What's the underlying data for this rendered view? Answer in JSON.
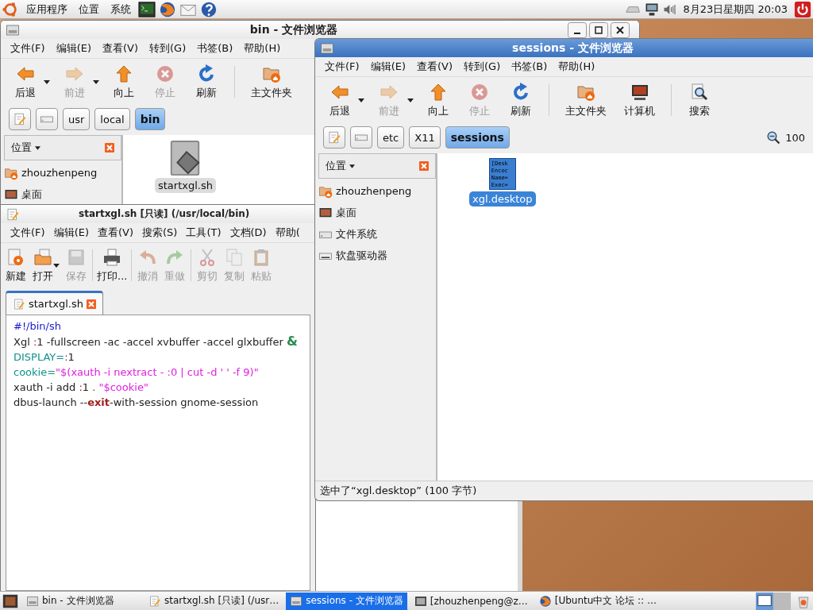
{
  "top_panel": {
    "menus": [
      {
        "label": "应用程序"
      },
      {
        "label": "位置"
      },
      {
        "label": "系统"
      }
    ],
    "clock": "8月23日星期四 20:03"
  },
  "file_browsers": [
    {
      "title": "bin - 文件浏览器",
      "active": false,
      "window_controls": true,
      "menu": [
        "文件(F)",
        "编辑(E)",
        "查看(V)",
        "转到(G)",
        "书签(B)",
        "帮助(H)"
      ],
      "toolbar": [
        {
          "kind": "back",
          "label": "后退",
          "disabled": false,
          "has_menu": true
        },
        {
          "kind": "forward",
          "label": "前进",
          "disabled": true,
          "has_menu": true
        },
        {
          "kind": "up",
          "label": "向上",
          "disabled": false,
          "has_menu": false
        },
        {
          "kind": "stop",
          "label": "停止",
          "disabled": true,
          "has_menu": false
        },
        {
          "kind": "reload",
          "label": "刷新",
          "disabled": false,
          "has_menu": false
        },
        {
          "kind": "separator"
        },
        {
          "kind": "home",
          "label": "主文件夹",
          "disabled": false,
          "has_menu": false
        }
      ],
      "path": [
        {
          "kind": "edit",
          "selected": false
        },
        {
          "kind": "disk",
          "selected": false
        },
        {
          "kind": "folder",
          "label": "usr",
          "selected": false
        },
        {
          "kind": "folder",
          "label": "local",
          "selected": false
        },
        {
          "kind": "folder",
          "label": "bin",
          "selected": true
        }
      ],
      "sidebar": {
        "title": "位置",
        "places": [
          {
            "kind": "home",
            "label": "zhouzhenpeng"
          },
          {
            "kind": "desktop",
            "label": "桌面"
          }
        ]
      },
      "files": [
        {
          "kind": "script",
          "name": "startxgl.sh",
          "selected": true
        }
      ]
    },
    {
      "title": "sessions - 文件浏览器",
      "active": true,
      "menu": [
        "文件(F)",
        "编辑(E)",
        "查看(V)",
        "转到(G)",
        "书签(B)",
        "帮助(H)"
      ],
      "toolbar": [
        {
          "kind": "back",
          "label": "后退",
          "disabled": false,
          "has_menu": true
        },
        {
          "kind": "forward",
          "label": "前进",
          "disabled": true,
          "has_menu": true
        },
        {
          "kind": "up",
          "label": "向上",
          "disabled": false,
          "has_menu": false
        },
        {
          "kind": "stop",
          "label": "停止",
          "disabled": true,
          "has_menu": false
        },
        {
          "kind": "reload",
          "label": "刷新",
          "disabled": false,
          "has_menu": false
        },
        {
          "kind": "separator"
        },
        {
          "kind": "home",
          "label": "主文件夹",
          "disabled": false,
          "has_menu": false
        },
        {
          "kind": "computer",
          "label": "计算机",
          "disabled": false,
          "has_menu": false
        },
        {
          "kind": "separator"
        },
        {
          "kind": "search",
          "label": "搜索",
          "disabled": false,
          "has_menu": false
        }
      ],
      "path": [
        {
          "kind": "edit",
          "selected": false
        },
        {
          "kind": "disk",
          "selected": false
        },
        {
          "kind": "folder",
          "label": "etc",
          "selected": false
        },
        {
          "kind": "folder",
          "label": "X11",
          "selected": false
        },
        {
          "kind": "folder",
          "label": "sessions",
          "selected": true
        }
      ],
      "zoom": "100",
      "sidebar": {
        "title": "位置",
        "places": [
          {
            "kind": "home",
            "label": "zhouzhenpeng"
          },
          {
            "kind": "desktop",
            "label": "桌面"
          },
          {
            "kind": "drive",
            "label": "文件系统"
          },
          {
            "kind": "floppy",
            "label": "软盘驱动器"
          }
        ]
      },
      "files": [
        {
          "kind": "text",
          "name": "xgl.desktop",
          "selected": true,
          "preview": [
            "[Desk",
            "Encoc",
            "Name=",
            "Exec="
          ]
        }
      ],
      "status": "选中了“xgl.desktop” (100 字节)"
    }
  ],
  "editor": {
    "title": "startxgl.sh [只读] (/usr/local/bin)",
    "menu": [
      "文件(F)",
      "编辑(E)",
      "查看(V)",
      "搜索(S)",
      "工具(T)",
      "文档(D)",
      "帮助("
    ],
    "toolbar": [
      {
        "kind": "new",
        "label": "新建",
        "disabled": false,
        "has_menu": false
      },
      {
        "kind": "open",
        "label": "打开",
        "disabled": false,
        "has_menu": true
      },
      {
        "kind": "save",
        "label": "保存",
        "disabled": true,
        "has_menu": false
      },
      {
        "kind": "separator"
      },
      {
        "kind": "print",
        "label": "打印...",
        "disabled": false,
        "has_menu": false
      },
      {
        "kind": "separator"
      },
      {
        "kind": "undo",
        "label": "撤消",
        "disabled": true,
        "has_menu": false
      },
      {
        "kind": "redo",
        "label": "重做",
        "disabled": true,
        "has_menu": false
      },
      {
        "kind": "separator"
      },
      {
        "kind": "cut",
        "label": "剪切",
        "disabled": true,
        "has_menu": false
      },
      {
        "kind": "copy",
        "label": "复制",
        "disabled": true,
        "has_menu": false
      },
      {
        "kind": "paste",
        "label": "粘贴",
        "disabled": true,
        "has_menu": false
      }
    ],
    "tabs": [
      {
        "label": "startxgl.sh",
        "selected": true
      }
    ],
    "lines": [
      [
        {
          "kind": "comment",
          "text": "#!/bin/sh"
        }
      ],
      [
        {
          "kind": "plain",
          "text": "Xgl "
        },
        {
          "kind": "op",
          "text": ":"
        },
        {
          "kind": "plain",
          "text": "1 -fullscreen -ac -accel xvbuffer -accel glxbuffer "
        },
        {
          "kind": "amp",
          "text": "&"
        }
      ],
      [
        {
          "kind": "var",
          "text": "DISPLAY="
        },
        {
          "kind": "op",
          "text": ":"
        },
        {
          "kind": "plain",
          "text": "1"
        }
      ],
      [
        {
          "kind": "var",
          "text": "cookie="
        },
        {
          "kind": "string",
          "text": "\"$(xauth -i nextract - :0 | cut -d ' ' -f 9)\""
        }
      ],
      [
        {
          "kind": "plain",
          "text": "xauth -i add "
        },
        {
          "kind": "op",
          "text": ":"
        },
        {
          "kind": "plain",
          "text": "1 "
        },
        {
          "kind": "op",
          "text": "."
        },
        {
          "kind": "string",
          "text": " \"$cookie\""
        }
      ],
      [
        {
          "kind": "plain",
          "text": "dbus-launch --"
        },
        {
          "kind": "keyword",
          "text": "exit"
        },
        {
          "kind": "plain",
          "text": "-with-session gnome-session"
        }
      ]
    ]
  },
  "taskbar": {
    "items": [
      {
        "kind": "file_manager",
        "label": "bin - 文件浏览器",
        "selected": false
      },
      {
        "kind": "notepad",
        "label": "startxgl.sh [只读] (/usr…",
        "selected": false
      },
      {
        "kind": "file_manager",
        "label": "sessions - 文件浏览器",
        "selected": true
      },
      {
        "kind": "terminal",
        "label": "[zhouzhenpeng@z…",
        "selected": false
      },
      {
        "kind": "browser",
        "label": "[Ubuntu中文 论坛 :: …",
        "selected": false
      }
    ]
  }
}
